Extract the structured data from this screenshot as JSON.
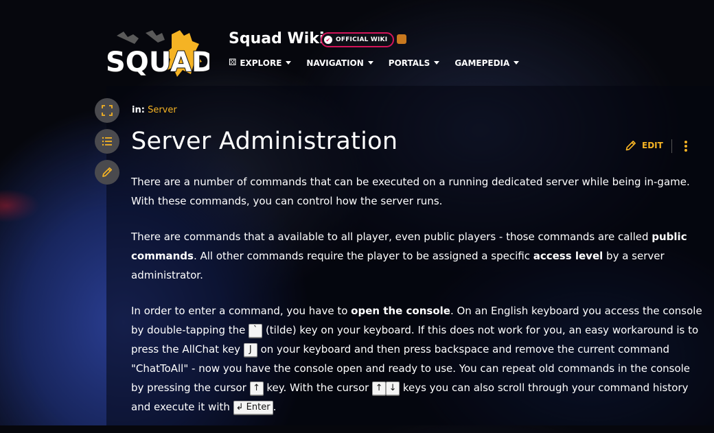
{
  "header": {
    "logo_text": "SQUAD",
    "wiki_title": "Squad Wiki",
    "badge_label": "OFFICIAL WIKI",
    "nav": [
      {
        "label": "EXPLORE"
      },
      {
        "label": "NAVIGATION"
      },
      {
        "label": "PORTALS"
      },
      {
        "label": "GAMEPEDIA"
      }
    ]
  },
  "breadcrumb": {
    "prefix": "in:",
    "link": "Server"
  },
  "page": {
    "title": "Server Administration",
    "edit_label": "EDIT"
  },
  "content": {
    "p1": "There are a number of commands that can be executed on a running dedicated server while being in-game. With these commands, you can control how the server runs.",
    "p2_a": "There are commands that a available to all player, even public players - those commands are called ",
    "p2_b": "public commands",
    "p2_c": ". All other commands require the player to be assigned a specific ",
    "p2_d": "access level",
    "p2_e": " by a server administrator.",
    "p3_a": "In order to enter a command, you have to ",
    "p3_b": "open the console",
    "p3_c": ". On an English keyboard you access the console by double-tapping the ",
    "key_tilde": "`",
    "p3_d": " (tilde) key on your keyboard. If this does not work for you, an easy workaround is to press the AllChat key ",
    "key_j": "J",
    "p3_e": " on your keyboard and then press backspace and remove the current command \"ChatToAll\" - now you have the console open and ready to use. You can repeat old commands in the console by pressing the cursor ",
    "key_up": "↑",
    "p3_f": " key. With the cursor ",
    "key_up2": "↑",
    "key_down": "↓",
    "p3_g": " keys you can also scroll through your command history and execute it with ",
    "key_enter": "↲ Enter",
    "p3_h": "."
  },
  "colors": {
    "accent": "#f5b324",
    "badge_border": "#d4145a",
    "tool_bg": "#4a4a4e"
  },
  "icons": {
    "side_tools": [
      "fullscreen-icon",
      "toc-list-icon",
      "pencil-edit-icon"
    ],
    "edit": "pencil-icon",
    "more": "kebab-menu-icon"
  }
}
